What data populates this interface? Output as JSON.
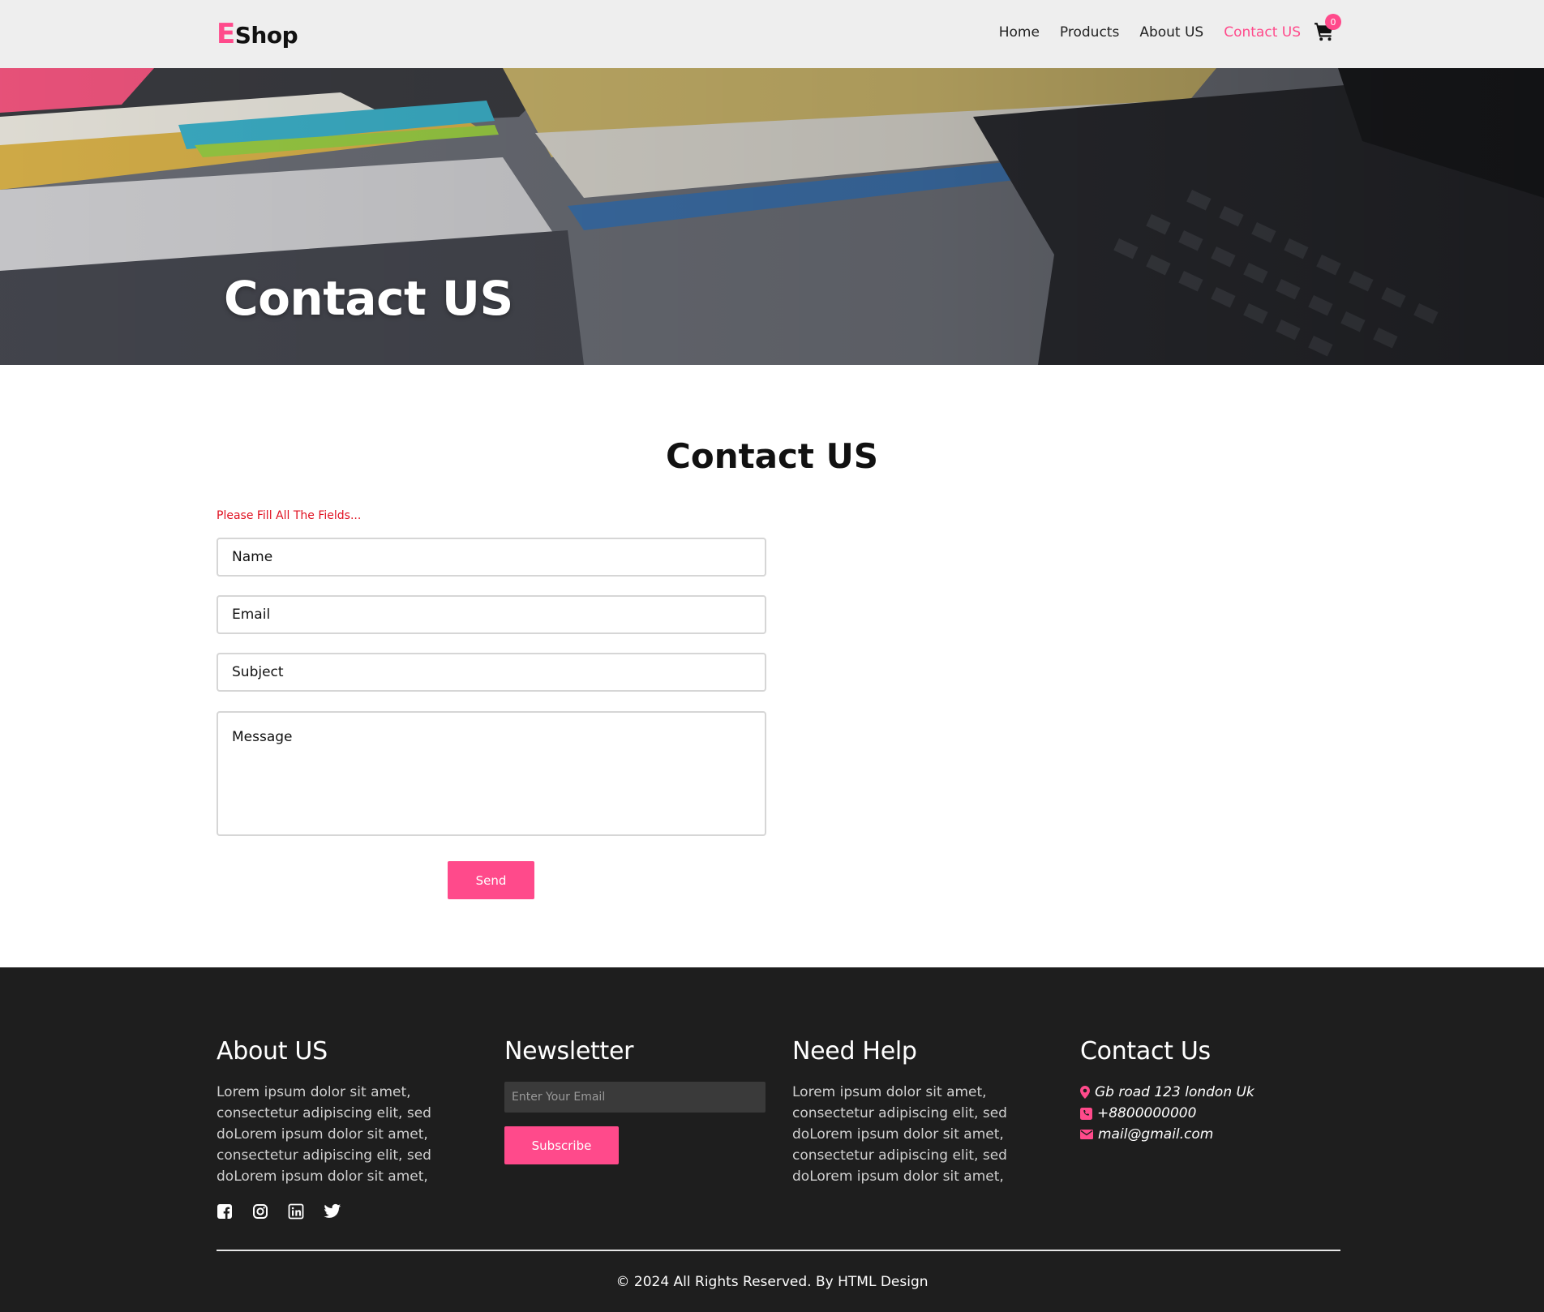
{
  "header": {
    "logo_letter": "E",
    "logo_rest": "Shop",
    "nav": [
      {
        "label": "Home",
        "active": false
      },
      {
        "label": "Products",
        "active": false
      },
      {
        "label": "About US",
        "active": false
      },
      {
        "label": "Contact US",
        "active": true
      }
    ],
    "cart_count": "0",
    "cart_icon": "cart-icon"
  },
  "hero": {
    "title": "Contact US"
  },
  "contact_section": {
    "title": "Contact US",
    "warning": "Please Fill All The Fields...",
    "fields": {
      "name_placeholder": "Name",
      "email_placeholder": "Email",
      "subject_placeholder": "Subject",
      "message_placeholder": "Message"
    },
    "send_label": "Send"
  },
  "footer": {
    "about": {
      "title": "About US",
      "body": "Lorem ipsum dolor sit amet, consectetur adipiscing elit, sed doLorem ipsum dolor sit amet, consectetur adipiscing elit, sed doLorem ipsum dolor sit amet,",
      "socials": [
        "facebook-icon",
        "instagram-icon",
        "linkedin-icon",
        "twitter-icon"
      ]
    },
    "newsletter": {
      "title": "Newsletter",
      "input_placeholder": "Enter Your Email",
      "subscribe_label": "Subscribe"
    },
    "help": {
      "title": "Need Help",
      "body": "Lorem ipsum dolor sit amet, consectetur adipiscing elit, sed doLorem ipsum dolor sit amet, consectetur adipiscing elit, sed doLorem ipsum dolor sit amet,"
    },
    "contact": {
      "title": "Contact Us",
      "address": "Gb road 123 london Uk",
      "phone": "+8800000000",
      "email": "mail@gmail.com"
    },
    "copyright": "© 2024 All Rights Reserved. By HTML Design"
  },
  "colors": {
    "accent": "#ff4a8b",
    "header_bg": "#eeeeee",
    "footer_bg": "#1e1e1e",
    "warning": "#e01020"
  }
}
